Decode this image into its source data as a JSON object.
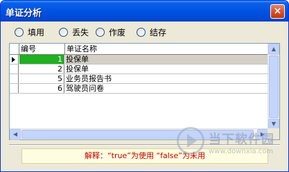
{
  "window": {
    "title": "单证分析",
    "close_label": "×"
  },
  "filters": [
    {
      "label": "填用"
    },
    {
      "label": "丢失"
    },
    {
      "label": "作废"
    },
    {
      "label": "结存"
    }
  ],
  "table": {
    "columns": [
      "编号",
      "单证名称"
    ],
    "rows": [
      {
        "num": "1",
        "name": "投保单",
        "selected": true
      },
      {
        "num": "2",
        "name": "投保单",
        "selected": false
      },
      {
        "num": "5",
        "name": "业务员报告书",
        "selected": false
      },
      {
        "num": "6",
        "name": "驾驶员问卷",
        "selected": false
      }
    ]
  },
  "note": {
    "text": "解释：“true”为使用  “false”为未用"
  },
  "watermark": {
    "brand": "当下软件园",
    "url": "www.downxia.com"
  },
  "colors": {
    "title_bar": "#0054e3",
    "selected_num_bg": "#20b020",
    "note_text": "#c00000"
  }
}
